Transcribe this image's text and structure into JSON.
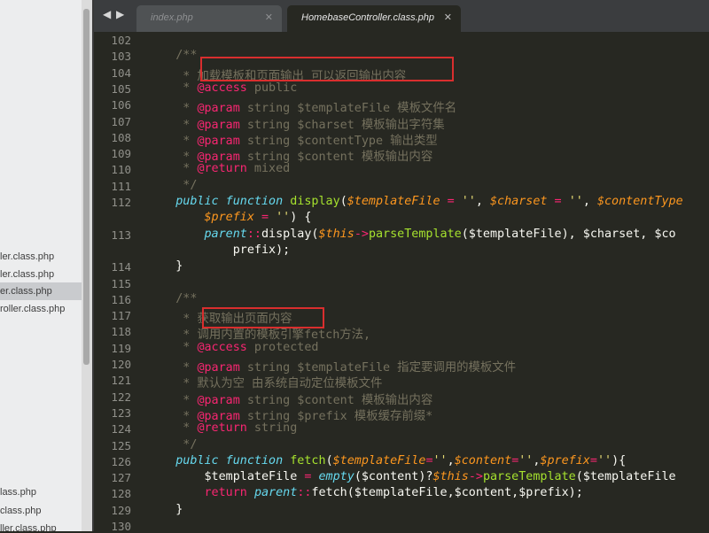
{
  "sidebar": {
    "files": [
      {
        "name": "ler.class.php",
        "selected": false
      },
      {
        "name": "ler.class.php",
        "selected": false
      },
      {
        "name": "er.class.php",
        "selected": true
      },
      {
        "name": "roller.class.php",
        "selected": false
      },
      {
        "name": "lass.php",
        "selected": false
      },
      {
        "name": "class.php",
        "selected": false
      },
      {
        "name": "ller.class.php",
        "selected": false
      }
    ]
  },
  "tabs": {
    "back_arrow": "◀",
    "forward_arrow": "▶",
    "items": [
      {
        "label": "index.php",
        "close": "✕",
        "active": false
      },
      {
        "label": "HomebaseController.class.php",
        "close": "✕",
        "active": true
      }
    ]
  },
  "editor": {
    "colors": {
      "background": "#272822",
      "comment": "#75715e",
      "keyword": "#f92672",
      "function": "#a6e22e",
      "string": "#e6db74",
      "highlight_box": "#d92e2e"
    },
    "lines": [
      {
        "num": "102",
        "tokens": [
          [
            "v",
            ""
          ]
        ]
      },
      {
        "num": "103",
        "tokens": [
          [
            "c",
            "    /**"
          ]
        ]
      },
      {
        "num": "104",
        "tokens": [
          [
            "c",
            "     * 加载模板和页面输出 可以返回输出内容"
          ]
        ]
      },
      {
        "num": "105",
        "tokens": [
          [
            "c",
            "     * "
          ],
          [
            "tag",
            "@access"
          ],
          [
            "c",
            " public"
          ]
        ]
      },
      {
        "num": "106",
        "tokens": [
          [
            "c",
            "     * "
          ],
          [
            "tag",
            "@param"
          ],
          [
            "c",
            " string $templateFile 模板文件名"
          ]
        ]
      },
      {
        "num": "107",
        "tokens": [
          [
            "c",
            "     * "
          ],
          [
            "tag",
            "@param"
          ],
          [
            "c",
            " string $charset 模板输出字符集"
          ]
        ]
      },
      {
        "num": "108",
        "tokens": [
          [
            "c",
            "     * "
          ],
          [
            "tag",
            "@param"
          ],
          [
            "c",
            " string $contentType 输出类型"
          ]
        ]
      },
      {
        "num": "109",
        "tokens": [
          [
            "c",
            "     * "
          ],
          [
            "tag",
            "@param"
          ],
          [
            "c",
            " string $content 模板输出内容"
          ]
        ]
      },
      {
        "num": "110",
        "tokens": [
          [
            "c",
            "     * "
          ],
          [
            "tag",
            "@return"
          ],
          [
            "c",
            " mixed"
          ]
        ]
      },
      {
        "num": "111",
        "tokens": [
          [
            "c",
            "     */"
          ]
        ]
      },
      {
        "num": "112",
        "tokens": [
          [
            "kf",
            "    public function "
          ],
          [
            "fn",
            "display"
          ],
          [
            "v",
            "("
          ],
          [
            "p",
            "$templateFile"
          ],
          [
            "k",
            " = "
          ],
          [
            "s",
            "''"
          ],
          [
            "v",
            ", "
          ],
          [
            "p",
            "$charset"
          ],
          [
            "k",
            " = "
          ],
          [
            "s",
            "''"
          ],
          [
            "v",
            ", "
          ],
          [
            "p",
            "$contentType"
          ]
        ]
      },
      {
        "num": "",
        "tokens": [
          [
            "v",
            "        "
          ],
          [
            "p",
            "$prefix"
          ],
          [
            "k",
            " = "
          ],
          [
            "s",
            "''"
          ],
          [
            "v",
            ") {"
          ]
        ]
      },
      {
        "num": "113",
        "tokens": [
          [
            "v",
            "        "
          ],
          [
            "kf",
            "parent"
          ],
          [
            "k",
            "::"
          ],
          [
            "v",
            "display("
          ],
          [
            "p",
            "$this"
          ],
          [
            "k",
            "->"
          ],
          [
            "fn",
            "parseTemplate"
          ],
          [
            "v",
            "($templateFile), $charset, $co"
          ]
        ]
      },
      {
        "num": "",
        "tokens": [
          [
            "v",
            "            prefix);"
          ]
        ]
      },
      {
        "num": "114",
        "tokens": [
          [
            "v",
            "    }"
          ]
        ]
      },
      {
        "num": "115",
        "tokens": [
          [
            "v",
            ""
          ]
        ]
      },
      {
        "num": "116",
        "tokens": [
          [
            "c",
            "    /**"
          ]
        ]
      },
      {
        "num": "117",
        "tokens": [
          [
            "c",
            "     * 获取输出页面内容"
          ]
        ]
      },
      {
        "num": "118",
        "tokens": [
          [
            "c",
            "     * 调用内置的模板引擎fetch方法,"
          ]
        ]
      },
      {
        "num": "119",
        "tokens": [
          [
            "c",
            "     * "
          ],
          [
            "tag",
            "@access"
          ],
          [
            "c",
            " protected"
          ]
        ]
      },
      {
        "num": "120",
        "tokens": [
          [
            "c",
            "     * "
          ],
          [
            "tag",
            "@param"
          ],
          [
            "c",
            " string $templateFile 指定要调用的模板文件"
          ]
        ]
      },
      {
        "num": "121",
        "tokens": [
          [
            "c",
            "     * 默认为空 由系统自动定位模板文件"
          ]
        ]
      },
      {
        "num": "122",
        "tokens": [
          [
            "c",
            "     * "
          ],
          [
            "tag",
            "@param"
          ],
          [
            "c",
            " string $content 模板输出内容"
          ]
        ]
      },
      {
        "num": "123",
        "tokens": [
          [
            "c",
            "     * "
          ],
          [
            "tag",
            "@param"
          ],
          [
            "c",
            " string $prefix 模板缓存前缀*"
          ]
        ]
      },
      {
        "num": "124",
        "tokens": [
          [
            "c",
            "     * "
          ],
          [
            "tag",
            "@return"
          ],
          [
            "c",
            " string"
          ]
        ]
      },
      {
        "num": "125",
        "tokens": [
          [
            "c",
            "     */"
          ]
        ]
      },
      {
        "num": "126",
        "tokens": [
          [
            "kf",
            "    public function "
          ],
          [
            "fn",
            "fetch"
          ],
          [
            "v",
            "("
          ],
          [
            "p",
            "$templateFile"
          ],
          [
            "k",
            "="
          ],
          [
            "s",
            "''"
          ],
          [
            "v",
            ","
          ],
          [
            "p",
            "$content"
          ],
          [
            "k",
            "="
          ],
          [
            "s",
            "''"
          ],
          [
            "v",
            ","
          ],
          [
            "p",
            "$prefix"
          ],
          [
            "k",
            "="
          ],
          [
            "s",
            "''"
          ],
          [
            "v",
            "){"
          ]
        ]
      },
      {
        "num": "127",
        "tokens": [
          [
            "v",
            "        $templateFile "
          ],
          [
            "k",
            "="
          ],
          [
            "v",
            " "
          ],
          [
            "kf",
            "empty"
          ],
          [
            "v",
            "($content)?"
          ],
          [
            "p",
            "$this"
          ],
          [
            "k",
            "->"
          ],
          [
            "fn",
            "parseTemplate"
          ],
          [
            "v",
            "($templateFile"
          ]
        ]
      },
      {
        "num": "128",
        "tokens": [
          [
            "k",
            "        return "
          ],
          [
            "kf",
            "parent"
          ],
          [
            "k",
            "::"
          ],
          [
            "v",
            "fetch($templateFile,$content,$prefix);"
          ]
        ]
      },
      {
        "num": "129",
        "tokens": [
          [
            "v",
            "    }"
          ]
        ]
      },
      {
        "num": "130",
        "tokens": [
          [
            "v",
            ""
          ]
        ]
      }
    ]
  }
}
